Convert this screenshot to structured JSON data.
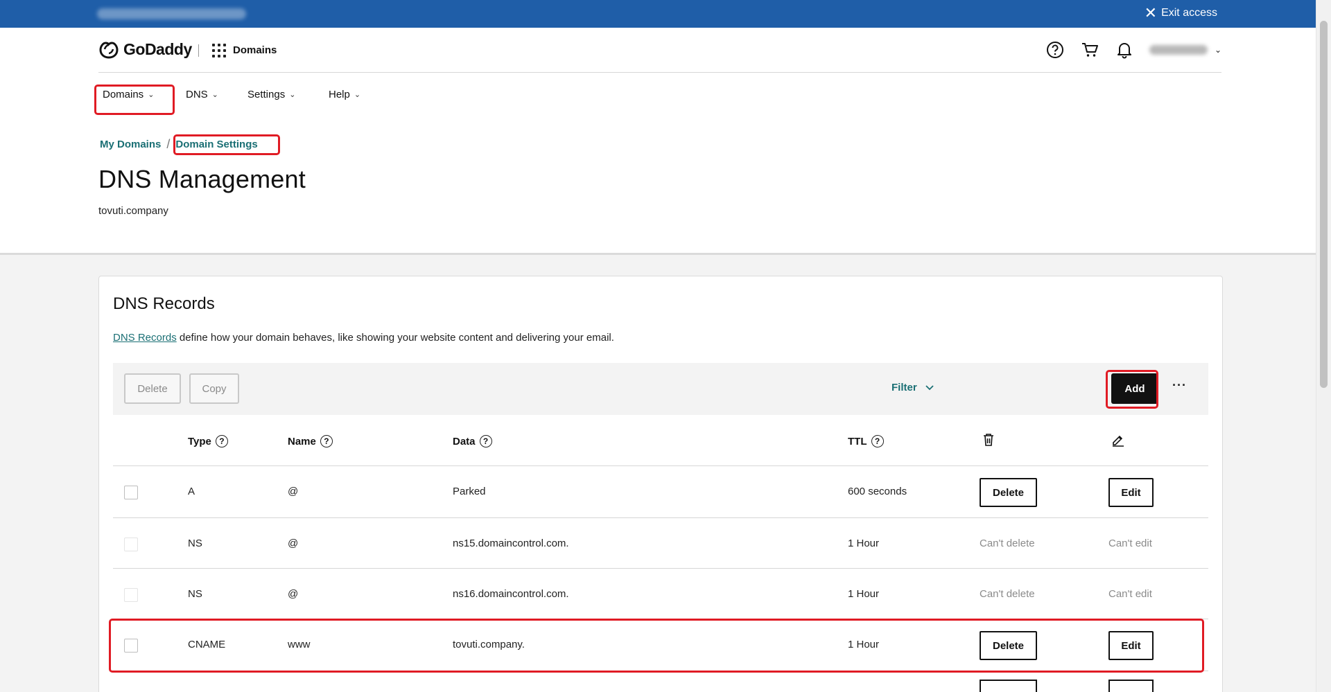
{
  "access_bar": {
    "exit_label": "Exit access"
  },
  "header": {
    "brand": "GoDaddy",
    "product": "Domains"
  },
  "nav": {
    "items": [
      {
        "label": "Domains"
      },
      {
        "label": "DNS"
      },
      {
        "label": "Settings"
      },
      {
        "label": "Help"
      }
    ]
  },
  "breadcrumb": {
    "root": "My Domains",
    "current": "Domain Settings"
  },
  "page": {
    "title": "DNS Management",
    "domain": "tovuti.company"
  },
  "records_card": {
    "title": "DNS Records",
    "desc_link": "DNS Records",
    "desc_text": " define how your domain behaves, like showing your website content and delivering your email."
  },
  "toolbar": {
    "delete_label": "Delete",
    "copy_label": "Copy",
    "filter_label": "Filter",
    "add_label": "Add",
    "more_label": "···"
  },
  "table": {
    "columns": {
      "type": "Type",
      "name": "Name",
      "data": "Data",
      "ttl": "TTL"
    },
    "help_glyph": "?",
    "rows": [
      {
        "type": "A",
        "name": "@",
        "data": "Parked",
        "ttl": "600 seconds",
        "delete": "Delete",
        "edit": "Edit"
      },
      {
        "type": "NS",
        "name": "@",
        "data": "ns15.domaincontrol.com.",
        "ttl": "1 Hour",
        "delete": "Can't delete",
        "edit": "Can't edit"
      },
      {
        "type": "NS",
        "name": "@",
        "data": "ns16.domaincontrol.com.",
        "ttl": "1 Hour",
        "delete": "Can't delete",
        "edit": "Can't edit"
      },
      {
        "type": "CNAME",
        "name": "www",
        "data": "tovuti.company.",
        "ttl": "1 Hour",
        "delete": "Delete",
        "edit": "Edit"
      }
    ]
  },
  "colors": {
    "access_bar": "#1f5ea8",
    "link_teal": "#1a6f74",
    "highlight_red": "#e01b24",
    "primary_button": "#111111"
  },
  "icons": {
    "close": "close-icon",
    "help": "help-icon",
    "cart": "cart-icon",
    "bell": "bell-icon",
    "apps": "apps-grid-icon",
    "trash": "trash-icon",
    "pencil": "pencil-icon"
  }
}
